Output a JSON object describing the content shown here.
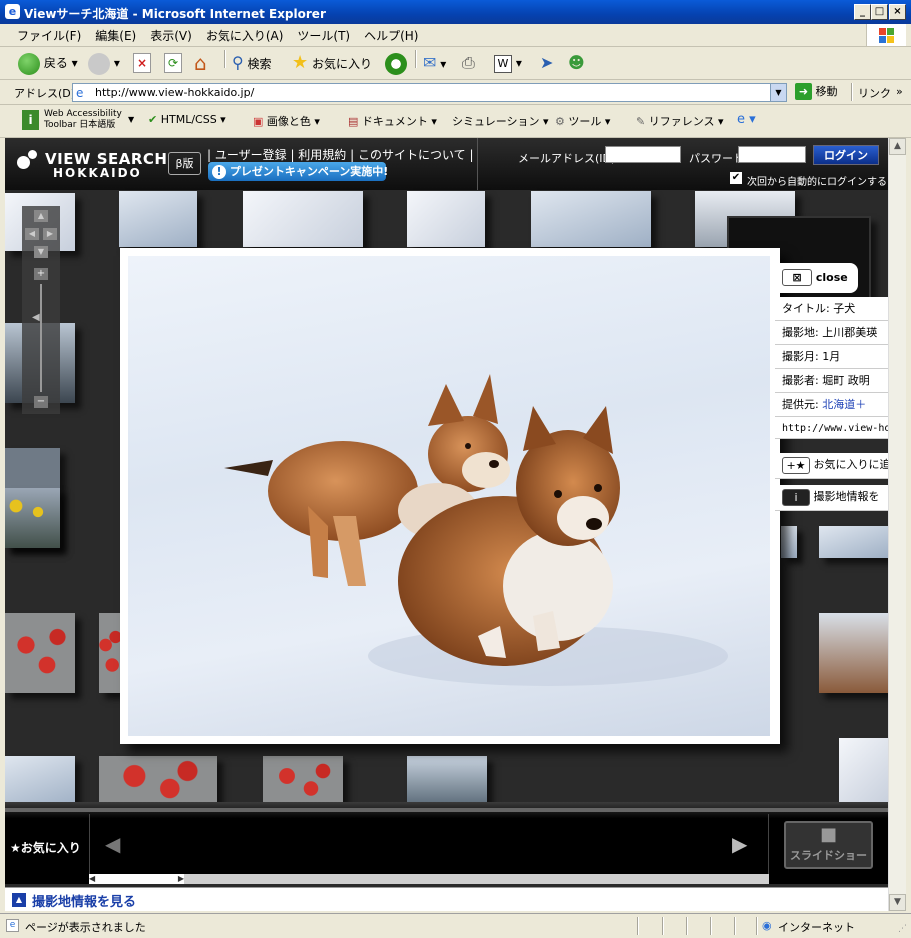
{
  "window": {
    "title": "Viewサーチ北海道 - Microsoft Internet Explorer"
  },
  "menu": [
    "ファイル(F)",
    "編集(E)",
    "表示(V)",
    "お気に入り(A)",
    "ツール(T)",
    "ヘルプ(H)"
  ],
  "toolbar": {
    "back": "戻る",
    "search": "検索",
    "favorites": "お気に入り"
  },
  "address": {
    "label": "アドレス(D)",
    "url": "http://www.view-hokkaido.jp/",
    "go": "移動",
    "links": "リンク"
  },
  "wat": {
    "title1": "Web Accessibility",
    "title2": "Toolbar 日本語版",
    "items": [
      "HTML/CSS",
      "画像と色",
      "ドキュメント",
      "シミュレーション",
      "ツール",
      "リファレンス"
    ]
  },
  "site": {
    "logo_line1": "VIEW SEARCH",
    "logo_line2": "HOKKAIDO",
    "beta": "β版",
    "nav": [
      "ユーザー登録",
      "利用規約",
      "このサイトについて"
    ],
    "campaign": "プレゼントキャンペーン実施中!",
    "email_label": "メールアドレス(ID)",
    "password_label": "パスワード",
    "login_button": "ログイン",
    "auto_login": "次回から自動的にログインする",
    "auto_login_checked": true
  },
  "popup": {
    "close": "close",
    "info": [
      {
        "label": "タイトル:",
        "value": "子犬"
      },
      {
        "label": "撮影地:",
        "value": "上川郡美瑛"
      },
      {
        "label": "撮影月:",
        "value": "1月"
      },
      {
        "label": "撮影者:",
        "value": "堀町 政明"
      },
      {
        "label": "提供元:",
        "value": "北海道＋"
      }
    ],
    "url": "http://www.view-ho",
    "add_favorite": "お気に入りに追",
    "location_info": "撮影地情報を"
  },
  "bottom": {
    "favorites": "お気に入り",
    "slideshow": "スライドショー"
  },
  "footer": {
    "link": "撮影地情報を見る"
  },
  "status": {
    "text": "ページが表示されました",
    "zone": "インターネット"
  }
}
